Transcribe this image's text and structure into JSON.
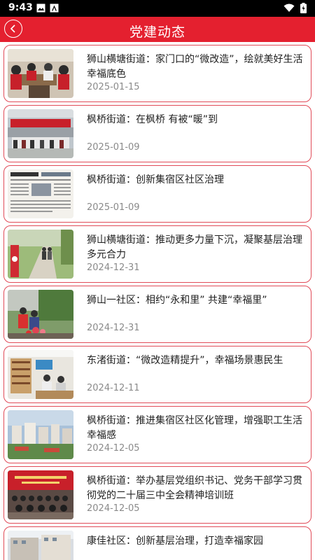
{
  "status": {
    "time": "9:43"
  },
  "header": {
    "title": "党建动态"
  },
  "articles": [
    {
      "title": "狮山横塘街道：家门口的“微改造”，绘就美好生活幸福底色",
      "date": "2025-01-15"
    },
    {
      "title": "枫桥街道：在枫桥 有被“暖”到",
      "date": "2025-01-09"
    },
    {
      "title": "枫桥街道：创新集宿区社区治理",
      "date": "2025-01-09"
    },
    {
      "title": "狮山横塘街道：推动更多力量下沉，凝聚基层治理多元合力",
      "date": "2024-12-31"
    },
    {
      "title": "狮山一社区：相约“永和里” 共建“幸福里”",
      "date": "2024-12-31"
    },
    {
      "title": "东渚街道：“微改造精提升”，幸福场景惠民生",
      "date": "2024-12-11"
    },
    {
      "title": "枫桥街道：推进集宿区社区化管理，增强职工生活幸福感",
      "date": "2024-12-05"
    },
    {
      "title": "枫桥街道：举办基层党组织书记、党务干部学习贯彻党的二十届三中全会精神培训班",
      "date": "2024-12-05"
    },
    {
      "title": "康佳社区：创新基层治理，打造幸福家园",
      "date": ""
    }
  ]
}
